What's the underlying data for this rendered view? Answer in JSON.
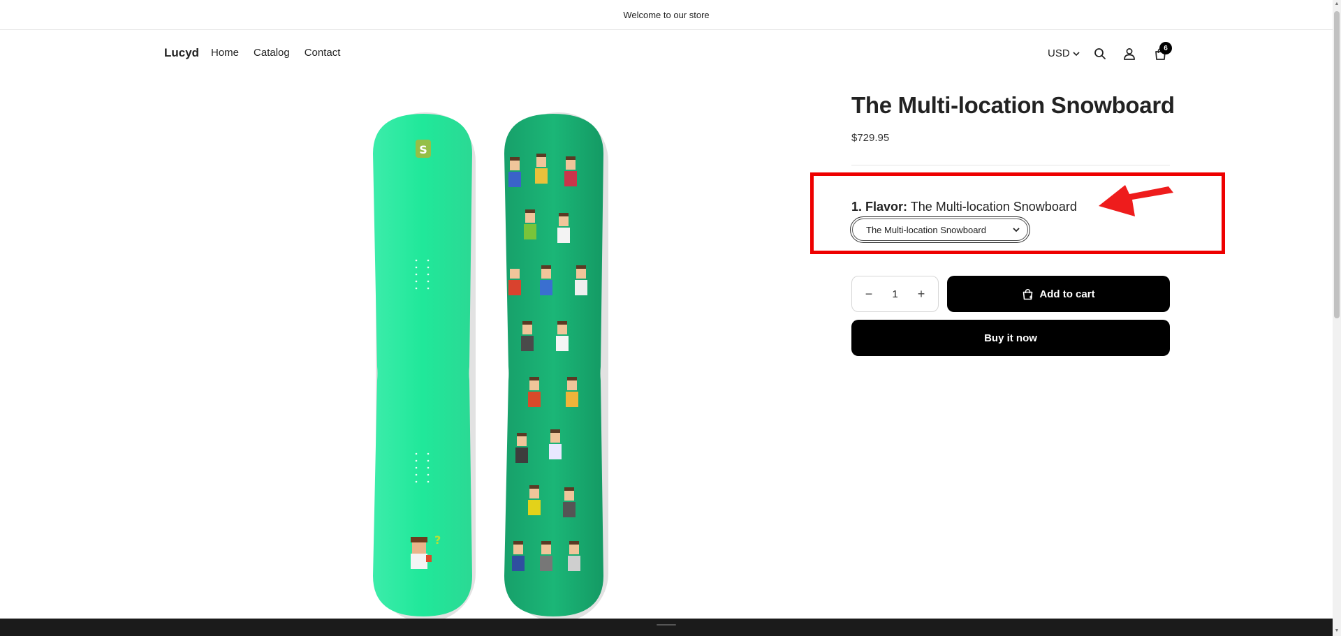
{
  "announcement": "Welcome to our store",
  "header": {
    "logo": "Lucyd",
    "nav": [
      "Home",
      "Catalog",
      "Contact"
    ],
    "currency": "USD",
    "cart_count": "6",
    "icons": [
      "search-icon",
      "account-icon",
      "cart-icon"
    ]
  },
  "product": {
    "title": "The Multi-location Snowboard",
    "price": "$729.95",
    "option": {
      "index_name": "1. Flavor:",
      "selected_label": "The Multi-location Snowboard",
      "select_value": "The Multi-location Snowboard"
    },
    "quantity": "1",
    "add_to_cart": "Add to cart",
    "buy_now": "Buy it now"
  },
  "colors": {
    "board_light": "#2fe8a0",
    "board_dark": "#13a86d",
    "highlight": "#ee0000",
    "button": "#000000"
  }
}
